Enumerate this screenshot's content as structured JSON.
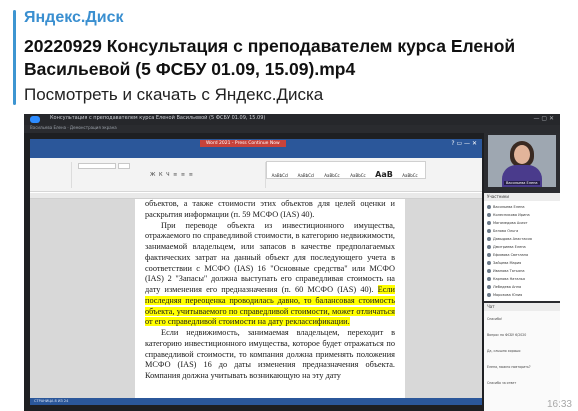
{
  "post": {
    "source": "Яндекс.Диск",
    "title": "20220929 Консультация с преподавателем курса Еленой Васильевой (5 ФСБУ 01.09, 15.09).mp4",
    "description": "Посмотреть и скачать с Яндекс.Диска",
    "time_partial": "16:33"
  },
  "colors": {
    "accent": "#3d95d1",
    "word_blue": "#2b579a",
    "highlight": "#ffff00"
  },
  "zoom": {
    "window_title": "Консультация с преподавателем курса Еленой Васильевой (5 ФСБУ 01.09, 15.09)",
    "meeting_info": "Васильева Елена · Демонстрация экрана",
    "participant_tile_name": "Васильева Елена",
    "participants_header": "Участники",
    "participants": [
      "Васильева Елена",
      "Колесникова Ирина",
      "Магомедова Асият",
      "Белова Ольга",
      "Давыдова Анастасия",
      "Дмитриева Елена",
      "Ефимова Светлана",
      "Зайцева Мария",
      "Иванова Татьяна",
      "Карпова Наталья",
      "Лебедева Анна",
      "Морозова Юлия"
    ],
    "chat_header": "Чат",
    "chat_messages": [
      "Спасибо!",
      "Вопрос по ФСБУ 6/2020",
      "Да, слышно хорошо",
      "Елена, можно повторить?",
      "Спасибо за ответ"
    ]
  },
  "word": {
    "doc_title": "Word 2021 - Press Continue Now",
    "tabs": [
      "ФАЙЛ",
      "ГЛАВНАЯ",
      "ВСТАВКА",
      "ДИЗАЙН",
      "РАЗМЕТКА СТРАНИЦЫ",
      "ССЫЛКИ",
      "РАССЫЛКИ",
      "РЕЦЕНЗИРОВАНИЕ",
      "ВИД"
    ],
    "styles": [
      "AaBbCcI",
      "AaBbCcI",
      "AaBbCc",
      "AaBbCc",
      "AaB",
      "AaBbCc"
    ],
    "status": "СТРАНИЦА 8 ИЗ 24",
    "para1": "объектов, а также стоимости этих объектов для целей оценки и раскрытия информации (п. 59 МСФО (IAS) 40).",
    "para2": "При переводе объекта из инвестиционного имущества, отражаемого по справедливой стоимости, в категорию недвижимости, занимаемой владельцем, или запасов в качестве предполагаемых фактических затрат на данный объект для последующего учета в соответствии с МСФО (IAS) 16 \"Основные средства\" или МСФО (IAS) 2 \"Запасы\" должна выступать его справедливая стоимость на дату изменения его предназначения (п. 60 МСФО (IAS) 40).",
    "para2_highlight": "Если последняя переоценка проводилась давно, то балансовая стоимость объекта, учитываемого по справедливой стоимости, может отличаться от его справедливой стоимости на дату реклассификации.",
    "para3": "Если недвижимость, занимаемая владельцем, переходит в категорию инвестиционного имущества, которое будет отражаться по справедливой стоимости, то компания должна применять положения МСФО (IAS) 16 до даты изменения предназначения объекта. Компания должна учитывать возникающую на эту дату"
  }
}
